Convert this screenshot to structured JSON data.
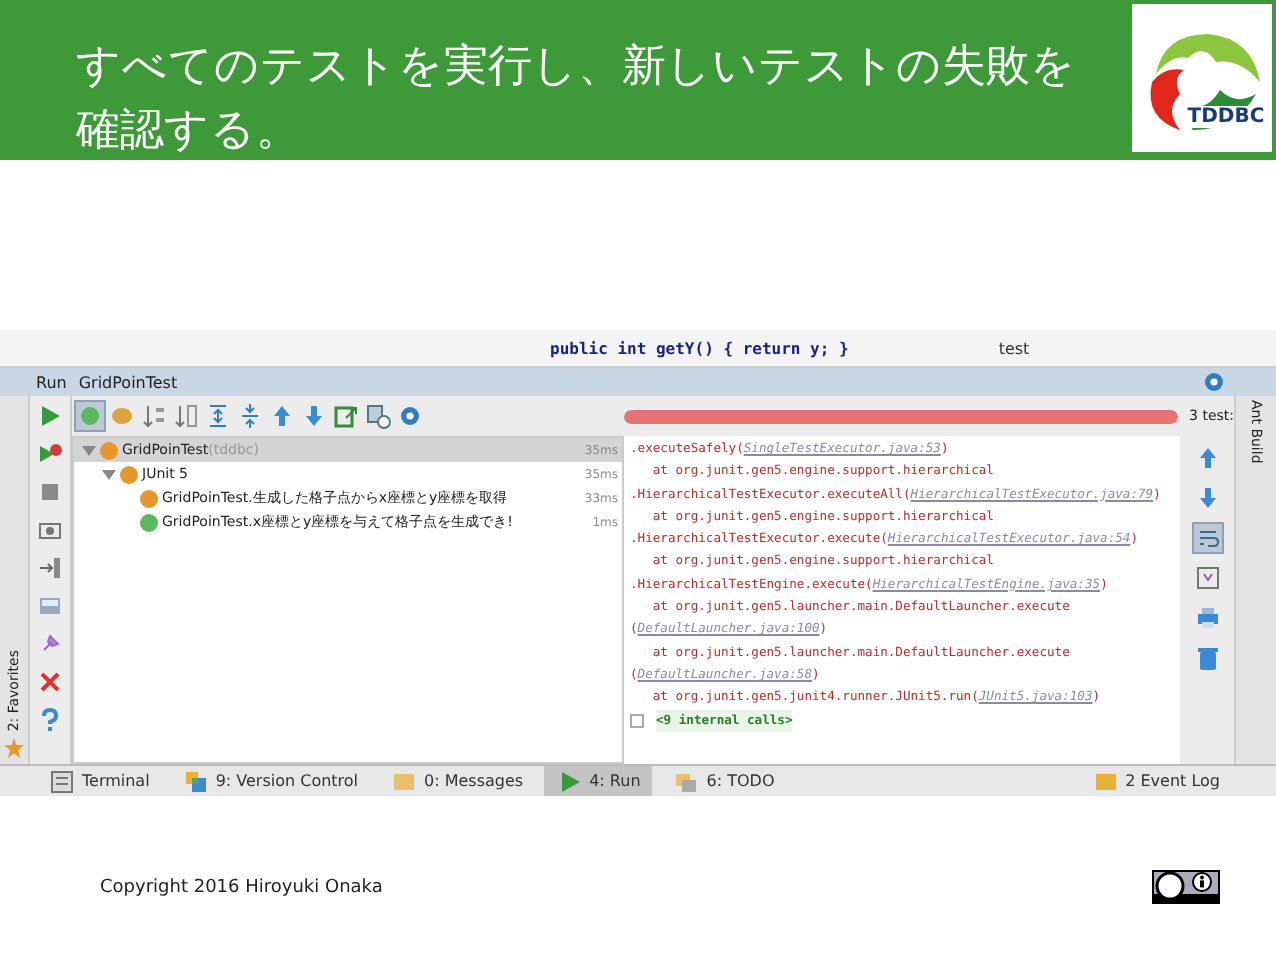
{
  "slide": {
    "title_lines": [
      "すべてのテストを実行し、新しいテストの失敗を",
      "確認する。"
    ],
    "logo_text": "TDDBC",
    "copyright": "Copyright 2016 Hiroyuki Onaka"
  },
  "editor": {
    "code": "public int getY() { return y; }",
    "project_item": "test"
  },
  "run_panel": {
    "title": "Run",
    "config": "GridPoinTest",
    "progress": {
      "level": 1,
      "failed": true,
      "count": "3 test:"
    }
  },
  "left_tools": [
    {
      "kind": "run"
    },
    {
      "kind": "rerun"
    },
    {
      "kind": "stop"
    },
    {
      "kind": "dump"
    },
    {
      "kind": "exit"
    },
    {
      "kind": "layout"
    },
    {
      "kind": "pin"
    },
    {
      "kind": "close"
    },
    {
      "kind": "help"
    }
  ],
  "tree_toolbar": [
    {
      "kind": "passed",
      "selected": true
    },
    {
      "kind": "ignored",
      "selected": false
    },
    {
      "kind": "sort",
      "selected": false
    },
    {
      "kind": "sort2",
      "selected": false
    },
    {
      "kind": "expand",
      "selected": false
    },
    {
      "kind": "collapse",
      "selected": false
    },
    {
      "kind": "up",
      "selected": false
    },
    {
      "kind": "down",
      "selected": false
    },
    {
      "kind": "export",
      "selected": false
    },
    {
      "kind": "history",
      "selected": false
    },
    {
      "kind": "gear",
      "selected": false
    }
  ],
  "test_tree": [
    {
      "name": "GridPoinTest",
      "suffix": "(tddbc)",
      "time": "35ms",
      "failed": true,
      "selected": true,
      "expanded": true,
      "children": [
        {
          "name": "JUnit 5",
          "time": "35ms",
          "failed": true,
          "selected": false,
          "expanded": true,
          "children": [
            {
              "name": "GridPoinTest.生成した格子点からx座標とy座標を取得",
              "time": "33ms",
              "failed": true,
              "selected": false
            },
            {
              "name": "GridPoinTest.x座標とy座標を与えて格子点を生成でき!",
              "time": "1ms",
              "failed": false,
              "selected": false
            }
          ]
        }
      ]
    }
  ],
  "console": [
    {
      "kind": "trace",
      "text": ".executeSafely(",
      "link": "SingleTestExecutor.java:53",
      "end": ")"
    },
    {
      "kind": "trace",
      "text": "   at org.junit.gen5.engine.support.hierarchical"
    },
    {
      "kind": "trace",
      "text": ".HierarchicalTestExecutor.executeAll(",
      "link": "HierarchicalTestExecutor.java:79",
      "end": ")"
    },
    {
      "kind": "trace",
      "text": "   at org.junit.gen5.engine.support.hierarchical"
    },
    {
      "kind": "trace",
      "text": ".HierarchicalTestExecutor.execute(",
      "link": "HierarchicalTestExecutor.java:54",
      "end": ")"
    },
    {
      "kind": "trace",
      "text": "   at org.junit.gen5.engine.support.hierarchical"
    },
    {
      "kind": "trace",
      "text": ".HierarchicalTestEngine.execute(",
      "link": "HierarchicalTestEngine.java:35",
      "end": ")"
    },
    {
      "kind": "trace",
      "text": "   at org.junit.gen5.launcher.main.DefaultLauncher.execute"
    },
    {
      "kind": "trace",
      "text": "(",
      "link": "DefaultLauncher.java:100",
      "end": ")"
    },
    {
      "kind": "trace",
      "text": "   at org.junit.gen5.launcher.main.DefaultLauncher.execute"
    },
    {
      "kind": "trace",
      "text": "(",
      "link": "DefaultLauncher.java:58",
      "end": ")"
    },
    {
      "kind": "trace",
      "text": "   at org.junit.gen5.junit4.runner.JUnit5.run(",
      "link": "JUnit5.java:103",
      "end": ")"
    },
    {
      "kind": "fold",
      "text": "<9 internal calls>"
    }
  ],
  "console_tools": [
    {
      "kind": "up",
      "selected": false
    },
    {
      "kind": "down",
      "selected": false
    },
    {
      "kind": "wrap",
      "selected": true
    },
    {
      "kind": "scrollend",
      "selected": false
    },
    {
      "kind": "print",
      "selected": false
    },
    {
      "kind": "trash",
      "selected": false
    }
  ],
  "side_stripes": {
    "left": "2: Favorites",
    "right": "Ant Build"
  },
  "bottom_tabs": [
    {
      "kind": "terminal",
      "label": "Terminal",
      "selected": false
    },
    {
      "kind": "vcs",
      "label": "9: Version Control",
      "selected": false
    },
    {
      "kind": "messages",
      "label": "0: Messages",
      "selected": false
    },
    {
      "kind": "run",
      "label": "4: Run",
      "selected": true
    },
    {
      "kind": "todo",
      "label": "6: TODO",
      "selected": false
    }
  ],
  "event_log": {
    "count": "2",
    "label": "Event Log"
  }
}
